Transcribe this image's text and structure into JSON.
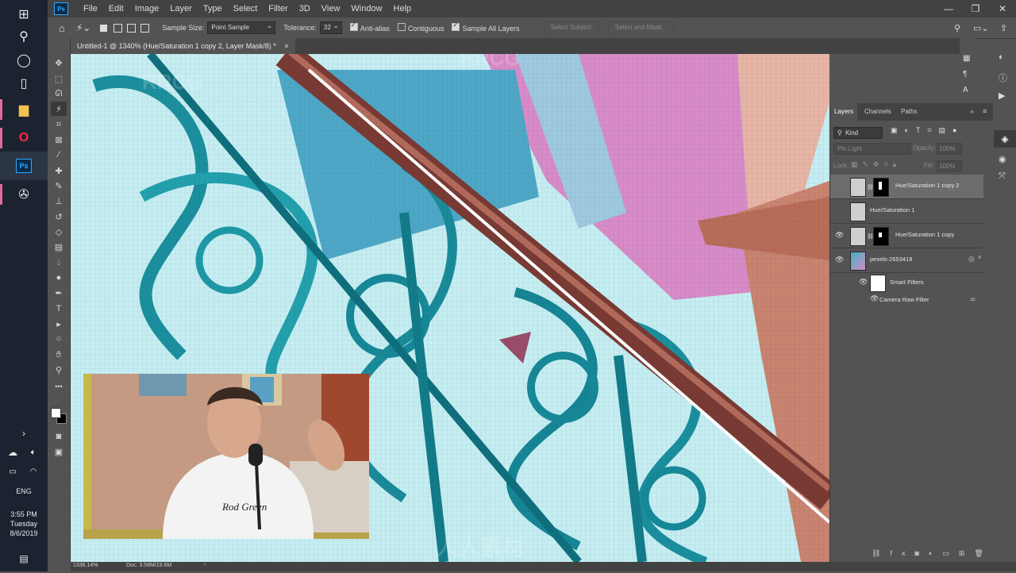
{
  "taskbar": {
    "clock_time": "3:55 PM",
    "clock_day": "Tuesday",
    "clock_date": "8/6/2019",
    "language": "ENG"
  },
  "menubar": {
    "app_logo": "Ps",
    "items": [
      "File",
      "Edit",
      "Image",
      "Layer",
      "Type",
      "Select",
      "Filter",
      "3D",
      "View",
      "Window",
      "Help"
    ]
  },
  "options": {
    "sample_size_label": "Sample Size:",
    "sample_size_value": "Point Sample",
    "tolerance_label": "Tolerance:",
    "tolerance_value": "32",
    "anti_alias_label": "Anti-alias",
    "contiguous_label": "Contiguous",
    "sample_all_label": "Sample All Layers",
    "select_subject_label": "Select Subject",
    "select_mask_label": "Select and Mask..."
  },
  "document": {
    "tab_title": "Untitled-1 @ 1340% (Hue/Saturation 1 copy 2, Layer Mask/8) *",
    "tab_close": "×"
  },
  "layers_panel": {
    "tabs": [
      "Layers",
      "Channels",
      "Paths"
    ],
    "filter_kind": "Kind",
    "blend_mode": "Pin Light",
    "opacity_label": "Opacity:",
    "opacity_value": "100%",
    "lock_label": "Lock:",
    "fill_label": "Fill:",
    "fill_value": "100%",
    "layers": [
      {
        "name": "Hue/Saturation 1 copy 2",
        "selected": true,
        "visible": false,
        "mask": true
      },
      {
        "name": "Hue/Saturation 1",
        "selected": false,
        "visible": false,
        "mask": false
      },
      {
        "name": "Hue/Saturation 1 copy",
        "selected": false,
        "visible": true,
        "mask": true
      },
      {
        "name": "pexels-2653418",
        "selected": false,
        "visible": true,
        "mask": false
      }
    ],
    "smart_filters_label": "Smart Filters",
    "camera_raw_label": "Camera Raw Filter"
  },
  "status": {
    "zoom": "1336.14%",
    "doc_size": "Doc: 3.58M/19.6M"
  },
  "webcam": {
    "shirt_text": "Rod Green"
  },
  "watermarks": [
    "RRCG",
    "人人素材"
  ],
  "colors": {
    "taskbar_bg": "#1c2330",
    "ps_panel": "#535353",
    "ps_dark": "#424242",
    "canvas_teal": "#37b8c4",
    "rail_brown": "#8b4a3f",
    "wall_pink": "#d98fc7"
  }
}
